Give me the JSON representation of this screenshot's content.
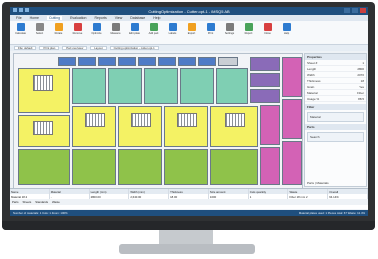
{
  "window": {
    "title": "CuttingOptimization - Cutter.opt-1 - iMSQ5 AB"
  },
  "menu": {
    "items": [
      "File",
      "Home",
      "Cutting",
      "Evaluation",
      "Reports",
      "View",
      "Database",
      "Help"
    ],
    "active": 2
  },
  "ribbon": {
    "buttons": [
      {
        "label": "Calculate",
        "icon": "calculator-icon",
        "color": "#2d7bd0"
      },
      {
        "label": "Select",
        "icon": "cursor-icon",
        "color": "#888888"
      },
      {
        "label": "Rotate",
        "icon": "rotate-icon",
        "color": "#f0a020"
      },
      {
        "label": "Remove",
        "icon": "remove-icon",
        "color": "#d84040"
      },
      {
        "label": "Optimize",
        "icon": "optimize-icon",
        "color": "#2d7bd0"
      },
      {
        "label": "Measure",
        "icon": "ruler-icon",
        "color": "#7b7b7b"
      },
      {
        "label": "Edit plate",
        "icon": "edit-icon",
        "color": "#2d7bd0"
      },
      {
        "label": "Add part",
        "icon": "add-icon",
        "color": "#49a35a"
      },
      {
        "label": "Labels",
        "icon": "label-icon",
        "color": "#2d7bd0"
      },
      {
        "label": "Export",
        "icon": "export-icon",
        "color": "#f0a020"
      },
      {
        "label": "Print",
        "icon": "print-icon",
        "color": "#2d7bd0"
      },
      {
        "label": "Settings",
        "icon": "gear-icon",
        "color": "#7b7b7b"
      },
      {
        "label": "Report",
        "icon": "report-icon",
        "color": "#49a35a"
      },
      {
        "label": "Close",
        "icon": "close-icon",
        "color": "#d84040"
      },
      {
        "label": "Help",
        "icon": "help-icon",
        "color": "#2d7bd0"
      }
    ]
  },
  "toolbar2": {
    "items": [
      "File: default",
      "Print plan",
      "Part overview",
      "Layout",
      "Cutting optimization - cutter.opt-1"
    ]
  },
  "props": {
    "header": "Properties",
    "rows": [
      [
        "Sheet #",
        "1"
      ],
      [
        "Length",
        "2800"
      ],
      [
        "Width",
        "2070"
      ],
      [
        "Thickness",
        "18"
      ],
      [
        "Grain",
        "Yes"
      ],
      [
        "Material",
        "Fiber"
      ],
      [
        "Usage %",
        "88.5"
      ]
    ],
    "filter_header": "Filter",
    "filter_value": "Material",
    "tab_header": "Parts",
    "search": "Search",
    "footer": "Parts  |  Materials"
  },
  "grid": {
    "headers": [
      "Name",
      "Material",
      "Length (mm)",
      "Width (mm)",
      "Thickness",
      "Size amount",
      "Cuts quantity",
      "Waste",
      "Overall"
    ],
    "row": [
      "Material 18.2",
      "-",
      "2800.00",
      "2,640.00",
      "18.00",
      "1000",
      "1",
      "Fiber 18 mm 2",
      "64.14%"
    ],
    "tabs": [
      "Parts",
      "Sheets",
      "Standards",
      "Waste"
    ]
  },
  "status": {
    "left": "Number of materials: 1   Cuts: 1        Zoom: 100%",
    "right": "Material plates used: 1   Pieces total: 67   Waste: 12.4%"
  },
  "colors": {
    "yellow": "#f4f264",
    "teal": "#7fcfb3",
    "green": "#8fc24a",
    "purple": "#8a6bb8",
    "magenta": "#d362b5",
    "blue": "#4f7bc6",
    "gray": "#c9ced4"
  }
}
